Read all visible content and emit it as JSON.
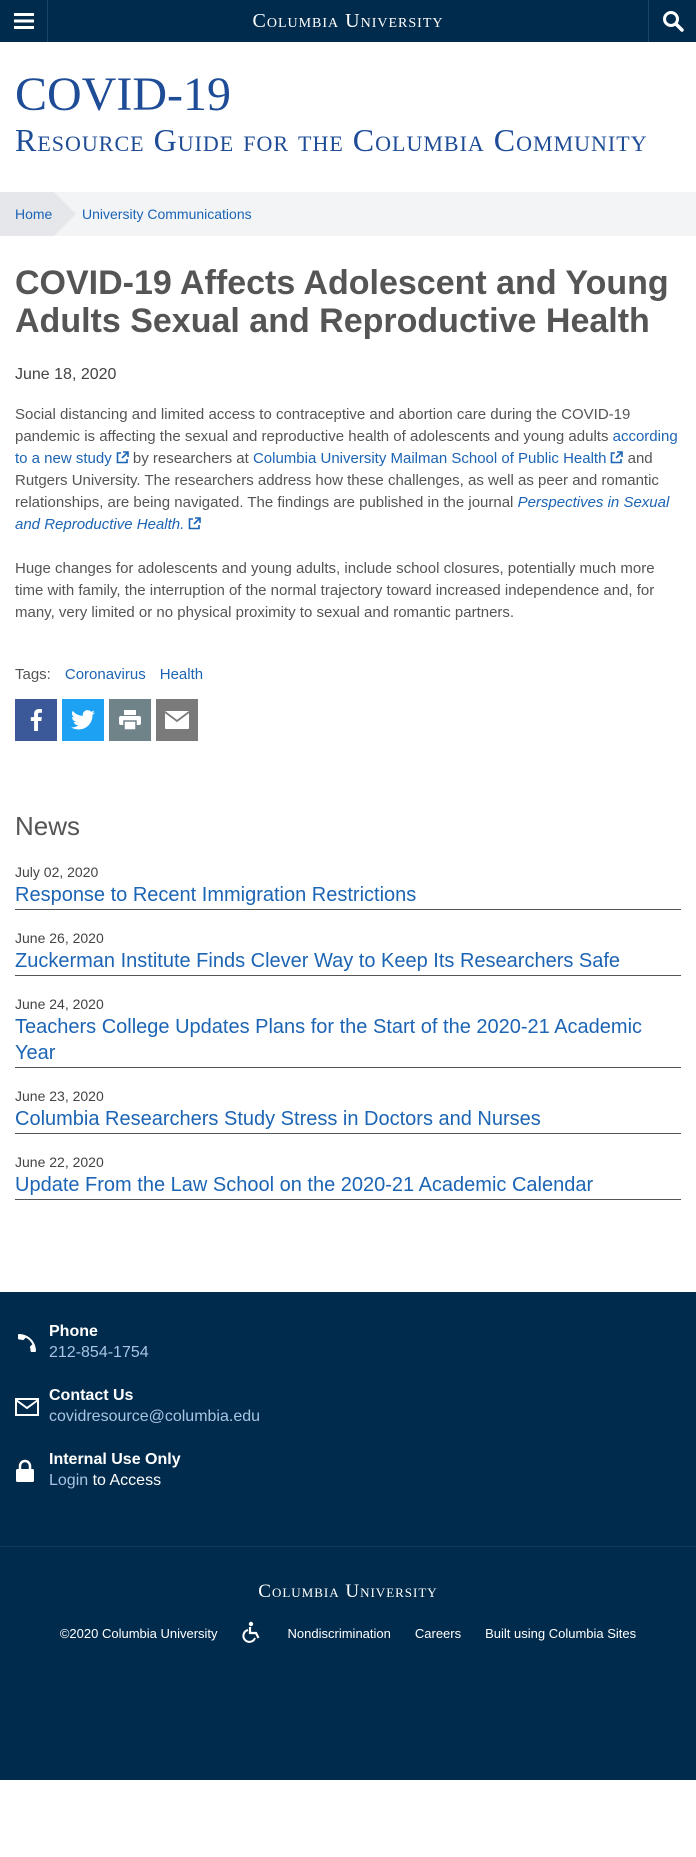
{
  "topbar": {
    "brand": "Columbia University",
    "menu_icon": "hamburger-icon",
    "search_icon": "search-icon"
  },
  "hero": {
    "title": "COVID-19",
    "subtitle": "Resource Guide for the Columbia Community"
  },
  "breadcrumb": {
    "home": "Home",
    "current": "University Communications"
  },
  "article": {
    "title": "COVID-19 Affects Adolescent and Young Adults Sexual and Reproductive Health",
    "date": "June 18, 2020",
    "p1": {
      "t1": "Social distancing and limited access to contraceptive and abortion care during the COVID-19 pandemic is affecting the sexual and reproductive health of adolescents and young adults ",
      "link1": "according to a new study",
      "t2": " by researchers at ",
      "link2": "Columbia University Mailman School of Public Health",
      "t3": " and Rutgers University. The researchers address how these challenges, as well as peer and romantic relationships, are being navigated. The findings are published in the journal ",
      "link3": "Perspectives in Sexual and Reproductive Health."
    },
    "p2": "Huge changes for adolescents and young adults, include school closures, potentially much more time with family, the interruption of the normal trajectory toward increased independence and, for many, very limited or no physical proximity to sexual and romantic partners."
  },
  "tags": {
    "label": "Tags:",
    "items": [
      "Coronavirus",
      "Health"
    ]
  },
  "share": [
    "facebook-icon",
    "twitter-icon",
    "print-icon",
    "email-icon"
  ],
  "news": {
    "heading": "News",
    "items": [
      {
        "date": "July 02, 2020",
        "title": "Response to Recent Immigration Restrictions"
      },
      {
        "date": "June 26, 2020",
        "title": "Zuckerman Institute Finds Clever Way to Keep Its Researchers Safe"
      },
      {
        "date": "June 24, 2020",
        "title": "Teachers College Updates Plans for the Start of the 2020-21 Academic Year"
      },
      {
        "date": "June 23, 2020",
        "title": "Columbia Researchers Study Stress in Doctors and Nurses"
      },
      {
        "date": "June 22, 2020",
        "title": "Update From the Law School on the 2020-21 Academic Calendar"
      }
    ]
  },
  "contact": {
    "phone_title": "Phone",
    "phone": "212-854-1754",
    "contact_title": "Contact Us",
    "email": "covidresource@columbia.edu",
    "internal_title": "Internal Use Only",
    "login": "Login",
    "login_suffix": " to Access"
  },
  "footer": {
    "brand": "Columbia University",
    "copyright": "©2020 Columbia University",
    "accessibility_icon": "accessibility-icon",
    "nondiscrimination": "Nondiscrimination",
    "careers": "Careers",
    "built": "Built using Columbia Sites"
  },
  "colors": {
    "navy": "#002b4c",
    "link": "#1c64b4",
    "hero": "#1e4c96"
  }
}
